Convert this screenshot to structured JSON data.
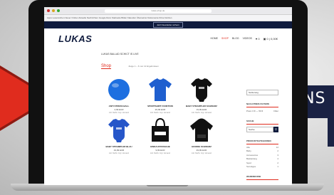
{
  "banner": {
    "text": "UNS"
  },
  "browser": {
    "url": "lukas-shop.de",
    "bookmarks": "Apps  Lesezeichen  Neuer Ordner  Aktuelle Nachrichten  Google Docs  Startseite  Bilder  Kalender  Übersetzer  Dokumente  Drive  Notizen"
  },
  "site": {
    "topbar_button": "Jetzt Newsletter sichern",
    "logo": "LUKAS",
    "nav": [
      {
        "label": "HOME",
        "active": false
      },
      {
        "label": "SHOP",
        "active": true
      },
      {
        "label": "BLOG",
        "active": false
      },
      {
        "label": "VIDEOS",
        "active": false
      }
    ],
    "account_icon": "♥ 0",
    "cart_label": "▣ 0 | 0,00€"
  },
  "main": {
    "crumb": "LUKAS BALLAD SCHICT IS LIVE",
    "title": "Shop",
    "result_note": "Zeige 1 – 6 von 12 Ergebnissen",
    "products": [
      {
        "name": "ANTI STRESS BALL",
        "price": "4,99 EUR",
        "note": "inkl. MwSt. zzgl. Versand",
        "icon": "ball-icon",
        "color": "#1d6fe0"
      },
      {
        "name": "SPORTSHIRT FUNKTION",
        "price": "29,99 EUR",
        "note": "inkl. MwSt. zzgl. Versand",
        "icon": "tshirt-icon",
        "color": "#1f5fcf"
      },
      {
        "name": "BABY STRAMPLER SCHWARZ",
        "price": "19,99 EUR",
        "note": "inkl. MwSt. zzgl. Versand",
        "icon": "bodysuit-icon",
        "color": "#111111"
      },
      {
        "name": "BABY STRAMPLER BLAU",
        "price": "19,99 EUR",
        "note": "inkl. MwSt. zzgl. Versand",
        "icon": "bodysuit-icon",
        "color": "#2656c9"
      },
      {
        "name": "EINKAUFSTASCHE",
        "price": "9,99 EUR",
        "note": "inkl. MwSt. zzgl. Versand",
        "icon": "tote-bag-icon",
        "color": "#111111"
      },
      {
        "name": "HOODIE SCHWARZ",
        "price": "49,99 EUR",
        "note": "inkl. MwSt. zzgl. Versand",
        "icon": "hoodie-icon",
        "color": "#111111"
      }
    ]
  },
  "sidebar": {
    "sort_select": "Sortierung",
    "price_filter_title": "NACH PREIS FILTERN",
    "price_range": "Preis: 0 € — 50 €",
    "filter_button": "Filter",
    "search_title": "SUCHE",
    "search_placeholder": "Suche",
    "categories_title": "PRODUKTKATEGORIEN",
    "categories": [
      {
        "name": "Alle",
        "count": "12"
      },
      {
        "name": "Baby",
        "count": "2"
      },
      {
        "name": "Accessoires",
        "count": "3"
      },
      {
        "name": "Bekleidung",
        "count": "4"
      },
      {
        "name": "Sport",
        "count": "2"
      },
      {
        "name": "Sonstiges",
        "count": "1"
      }
    ],
    "footer_title": "WARENKORB"
  }
}
